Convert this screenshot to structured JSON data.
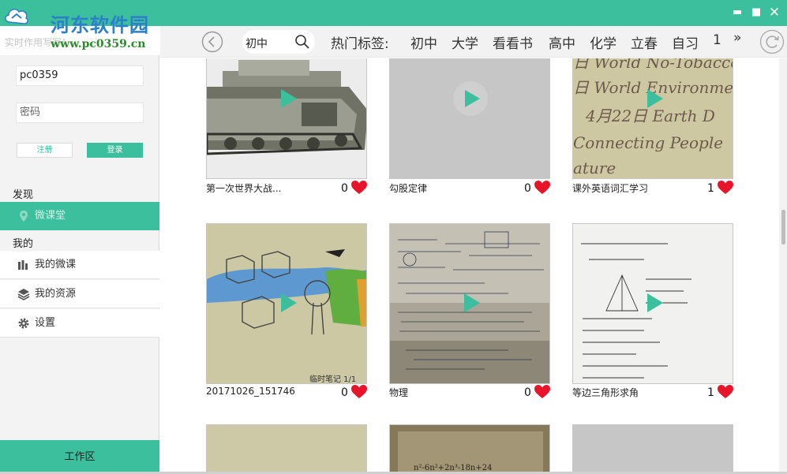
{
  "window": {
    "brand_color": "#3bbf9c",
    "minimize_icon": "minimize-icon",
    "maximize_icon": "maximize-icon",
    "close_icon": "close-icon"
  },
  "watermark": {
    "site_name": "河东软件园",
    "url": "www.pc0359.cn",
    "caption": "实时作用写写！"
  },
  "login": {
    "username": "pc0359",
    "password_placeholder": "密码",
    "register_label": "注册",
    "login_label": "登录"
  },
  "sidebar": {
    "discover_label": "发现",
    "microclass_label": "微课堂",
    "mine_label": "我的",
    "items": [
      {
        "label": "我的微课",
        "icon": "bar-chart-icon"
      },
      {
        "label": "我的资源",
        "icon": "layers-icon"
      },
      {
        "label": "设置",
        "icon": "gear-icon"
      }
    ],
    "workspace_label": "工作区"
  },
  "topbar": {
    "search_value": "初中",
    "hot_tags_label": "热门标签:",
    "tags": [
      "初中",
      "大学",
      "看看书",
      "高中",
      "化学",
      "立春",
      "自习",
      "1"
    ],
    "more_label": "»"
  },
  "cards": [
    {
      "title": "第一次世界大战...",
      "likes": "0",
      "thumb": "tank"
    },
    {
      "title": "勾股定律",
      "likes": "0",
      "thumb": "gray"
    },
    {
      "title": "课外英语词汇学习",
      "likes": "1",
      "thumb": "handwriting"
    },
    {
      "title": "20171026_151746",
      "likes": "0",
      "thumb": "drawing",
      "overlay": "临时笔记 1/1"
    },
    {
      "title": "物理",
      "likes": "0",
      "thumb": "notes"
    },
    {
      "title": "等边三角形求角",
      "likes": "1",
      "thumb": "geometry"
    },
    {
      "title": "",
      "likes": "",
      "thumb": "beige"
    },
    {
      "title": "",
      "likes": "",
      "thumb": "formula",
      "overlay": "n²-6n²+2n³-18n+24"
    },
    {
      "title": "",
      "likes": "",
      "thumb": "gray"
    }
  ],
  "handwriting_lines": [
    "日 World No-Tobacco",
    "日 World Environme",
    "4月22日 Earth D",
    "Connecting People",
    "ature"
  ]
}
